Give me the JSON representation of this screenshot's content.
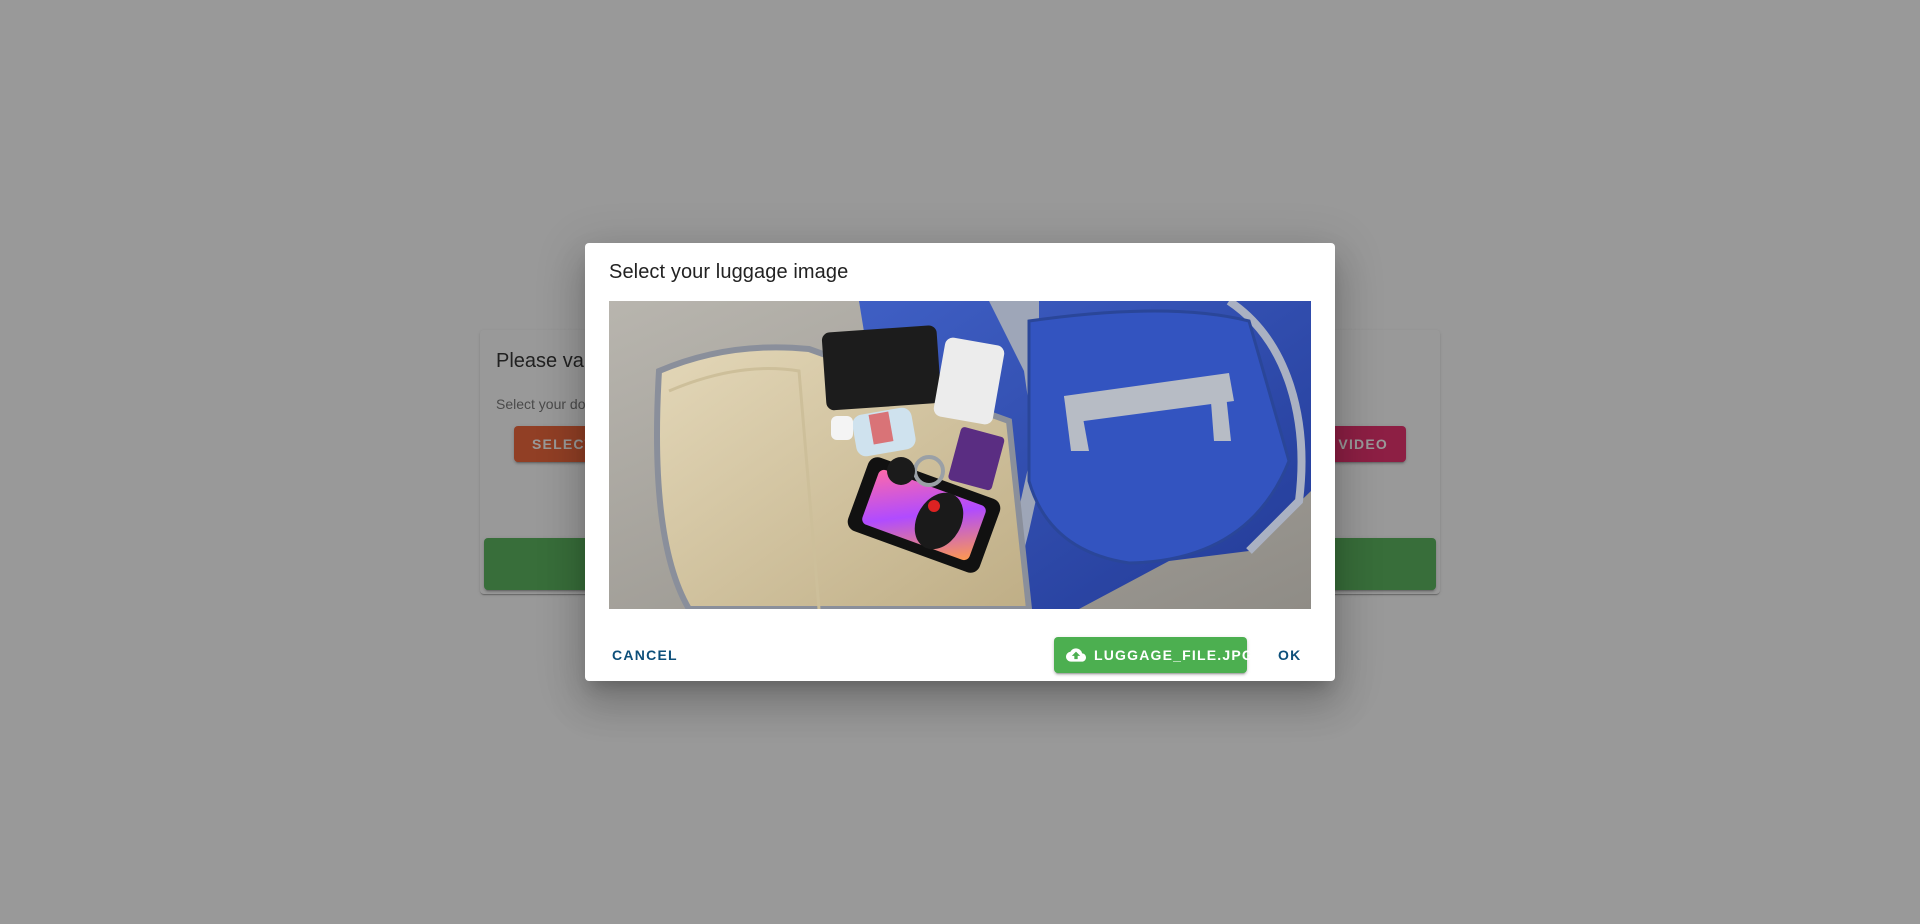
{
  "background": {
    "card_title": "Please va",
    "card_subtitle": "Select your do",
    "left_button_label": "SELECT",
    "right_button_label": "VIDEO"
  },
  "dialog": {
    "title": "Select your luggage image",
    "preview_alt": "luggage preview",
    "actions": {
      "cancel_label": "CANCEL",
      "file_label": "LUGGAGE_FILE.JPG",
      "file_icon": "cloud-upload-icon",
      "ok_label": "OK"
    }
  },
  "colors": {
    "primary_text": "#0d4f7a",
    "success": "#4caf50",
    "orange": "#f1592a",
    "pink": "#e91e63"
  }
}
